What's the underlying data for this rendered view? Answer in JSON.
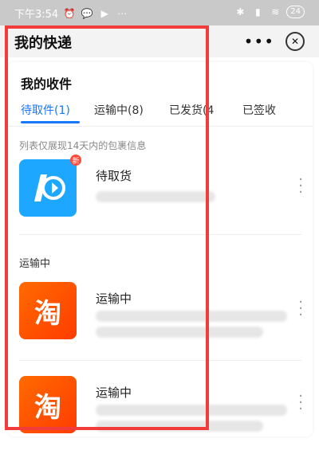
{
  "status_bar": {
    "time": "下午3:54",
    "battery": "24"
  },
  "header": {
    "title": "我的快递",
    "more_label": "•••",
    "close_label": "✕"
  },
  "card": {
    "section_title": "我的收件",
    "tabs": [
      {
        "label": "待取件(1)",
        "active": true
      },
      {
        "label": "运输中(8)",
        "active": false
      },
      {
        "label": "已发货(4",
        "active": false
      },
      {
        "label": "已签收",
        "active": false
      }
    ],
    "note": "列表仅展现14天内的包裹信息",
    "items": [
      {
        "title": "待取货",
        "badge": "新",
        "icon": "logistics-logo-icon"
      },
      {
        "title": "运输中",
        "icon": "taobao-logo-icon",
        "icon_text": "淘"
      },
      {
        "title": "运输中",
        "icon": "taobao-logo-icon",
        "icon_text": "淘"
      }
    ],
    "group_label": "运输中"
  },
  "colors": {
    "accent": "#1677ff",
    "annotation": "#f23c3c",
    "blue_logo": "#1ea7ff",
    "orange_logo": "#ff6a00"
  }
}
